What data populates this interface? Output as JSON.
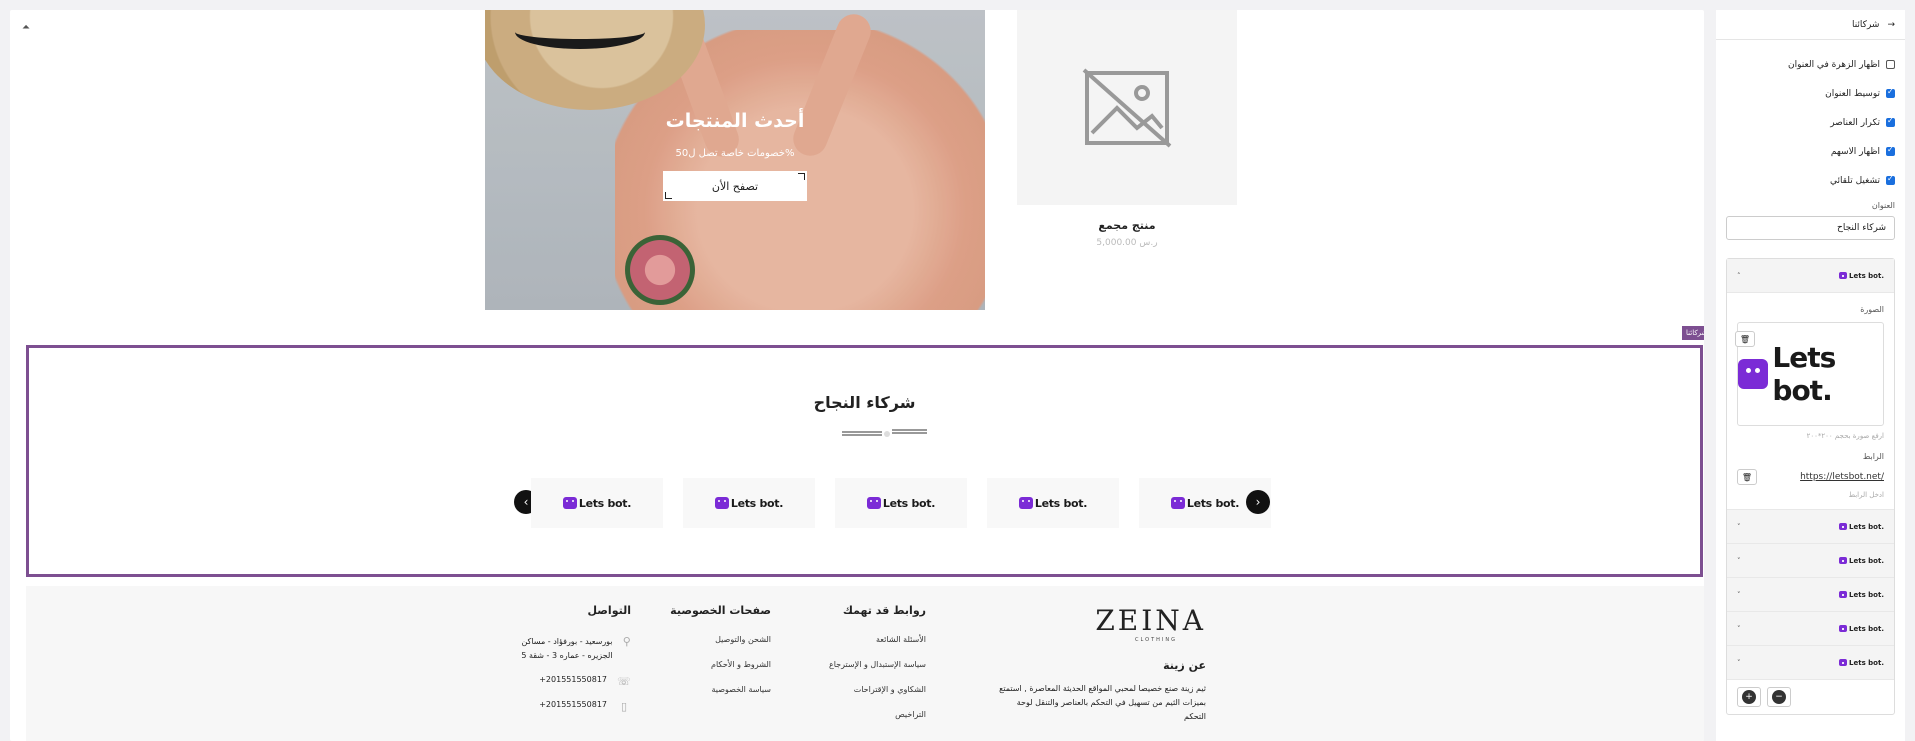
{
  "banner": {
    "title": "أحدث المنتجات",
    "subtitle": "خصومات خاصة تصل ل50%",
    "button": "تصفح الأن"
  },
  "product": {
    "name": "منتج مجمع",
    "price": "5,000.00 ر.س"
  },
  "partners_section": {
    "tag": "شركائنا",
    "title": "شركاء النجاح",
    "logo_text": "Lets bot.",
    "logos_count_label": "5"
  },
  "footer": {
    "brand": {
      "logo": "ZEINA",
      "logo_sub": "CLOTHING",
      "heading": "عن زينة",
      "text": "ثيم زينة صنع خصيصا لمحبي المواقع الحديثة المعاصرة , استمتع بميزات الثيم من تسهيل في التحكم بالعناصر والتنقل لوحة التحكم"
    },
    "links": {
      "heading": "روابط قد تهمك",
      "items": [
        "الأسئلة الشائعة",
        "سياسة الإستبدال و الإسترجاع",
        "الشكاوي و الإقتراحات",
        "التراخيص"
      ]
    },
    "privacy": {
      "heading": "صفحات الخصوصية",
      "items": [
        "الشحن والتوصيل",
        "الشروط و الأحكام",
        "سياسة الخصوصية"
      ]
    },
    "contact": {
      "heading": "التواصل",
      "address": "بورسعيد - بورفؤاد - مساكن الجزيره - عماره 3 - شقة 5",
      "phone": "+201551550817",
      "mobile": "+201551550817"
    }
  },
  "panel": {
    "title": "شركائنا",
    "checkboxes": [
      {
        "label": "اظهار الزهرة في العنوان",
        "checked": false
      },
      {
        "label": "توسيط العنوان",
        "checked": true
      },
      {
        "label": "تكرار العناصر",
        "checked": true
      },
      {
        "label": "اظهار الاسهم",
        "checked": true
      },
      {
        "label": "تشغيل تلقائي",
        "checked": true
      }
    ],
    "title_label": "العنوان",
    "title_value": "شركاء النجاح",
    "item_logo": "Lets bot.",
    "image_label": "الصورة",
    "image_hint": "ارفع صورة بحجم ٢٠٠*٢٠٠",
    "link_label": "الرابط",
    "link_value": "https://letsbot.net/",
    "link_hint": "ادخل الرابط"
  }
}
